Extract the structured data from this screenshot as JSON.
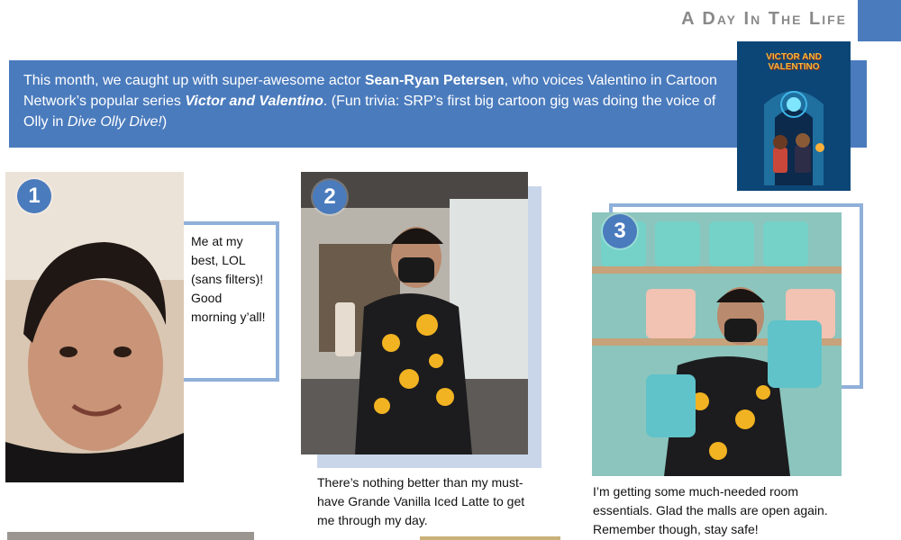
{
  "header": {
    "section_title": "A Day In The Life"
  },
  "intro": {
    "part1": "This month, we caught up with super-awesome actor ",
    "actor_name": "Sean-Ryan Petersen",
    "part2": ", who voices Valentino in Cartoon Network’s popular series ",
    "show_name": "Victor and Valentino",
    "part3": ". (Fun trivia: SRP’s first big cartoon gig was doing the voice of Olly in ",
    "first_show": "Dive Olly Dive!",
    "part4": ")"
  },
  "poster": {
    "logo_text": "VICTOR AND VALENTINO"
  },
  "photos": [
    {
      "number": "1",
      "caption": "Me at my best, LOL (sans filters)! Good morning y’all!"
    },
    {
      "number": "2",
      "caption": "There’s nothing better than my must-have Grande Vanilla Iced Latte to get me through my day."
    },
    {
      "number": "3",
      "caption": "I’m getting some much-needed room essentials. Glad the malls are open again. Remember though, stay safe!"
    }
  ],
  "colors": {
    "accent_blue": "#4a7bbd",
    "frame_blue": "#8fb0d9",
    "header_gray": "#8a8a8a"
  }
}
